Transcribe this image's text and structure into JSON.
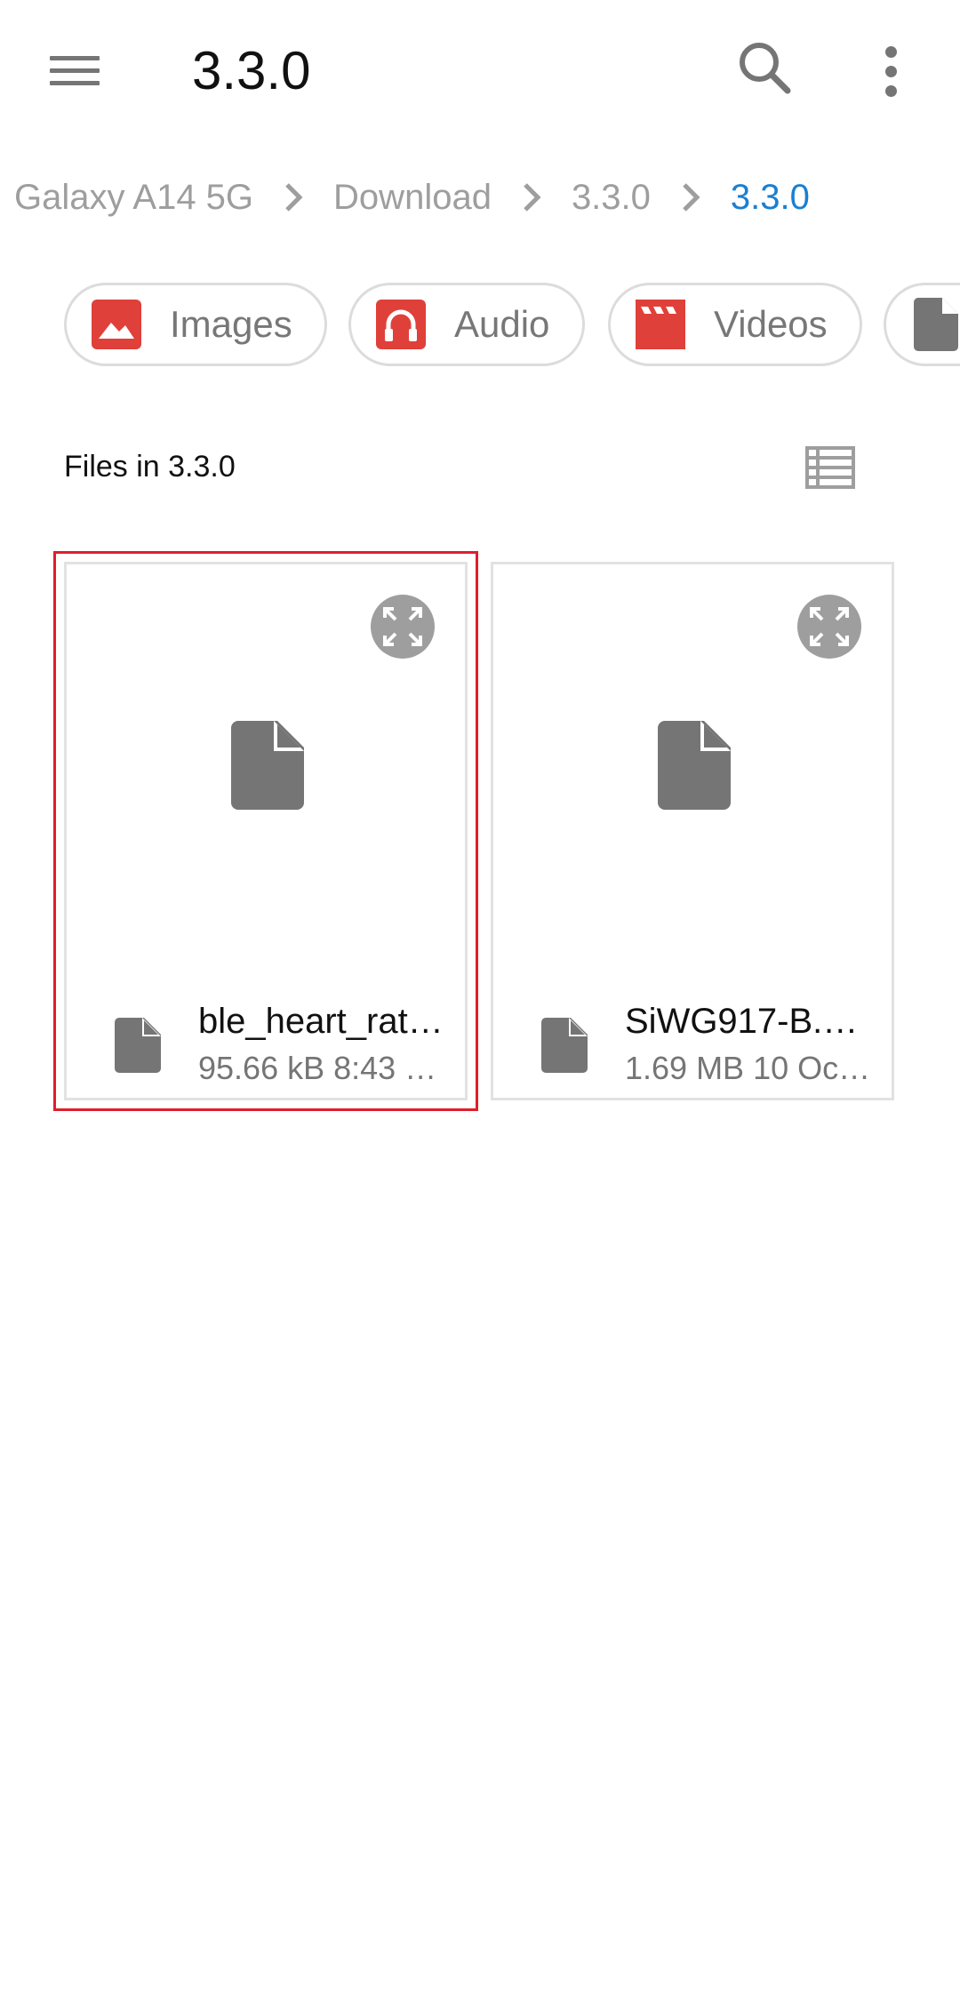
{
  "appbar": {
    "title": "3.3.0",
    "menu_icon": "hamburger-menu-icon",
    "search_icon": "search-icon",
    "more_icon": "more-vert-icon"
  },
  "breadcrumb": {
    "items": [
      "Galaxy A14 5G",
      "Download",
      "3.3.0",
      "3.3.0"
    ],
    "separator_icon": "chevron-right-icon",
    "active_color": "#1a7fd1"
  },
  "categories": [
    {
      "label": "Images",
      "icon": "image-icon",
      "color": "#e0403a"
    },
    {
      "label": "Audio",
      "icon": "headphones-icon",
      "color": "#e0403a"
    },
    {
      "label": "Videos",
      "icon": "clapperboard-icon",
      "color": "#e0403a"
    },
    {
      "label": "",
      "icon": "document-icon",
      "color": "#757575"
    }
  ],
  "section": {
    "title": "Files in 3.3.0",
    "view_toggle_icon": "list-view-icon"
  },
  "files": [
    {
      "name": "ble_heart_rat…",
      "info": "95.66 kB 8:43 …",
      "icon": "file-icon",
      "selected": true
    },
    {
      "name": "SiWG917-B.…",
      "info": "1.69 MB 10 Oc…",
      "icon": "file-icon",
      "selected": false
    }
  ],
  "colors": {
    "selection_outline": "#e01e2b",
    "icon_grey": "#757575"
  }
}
